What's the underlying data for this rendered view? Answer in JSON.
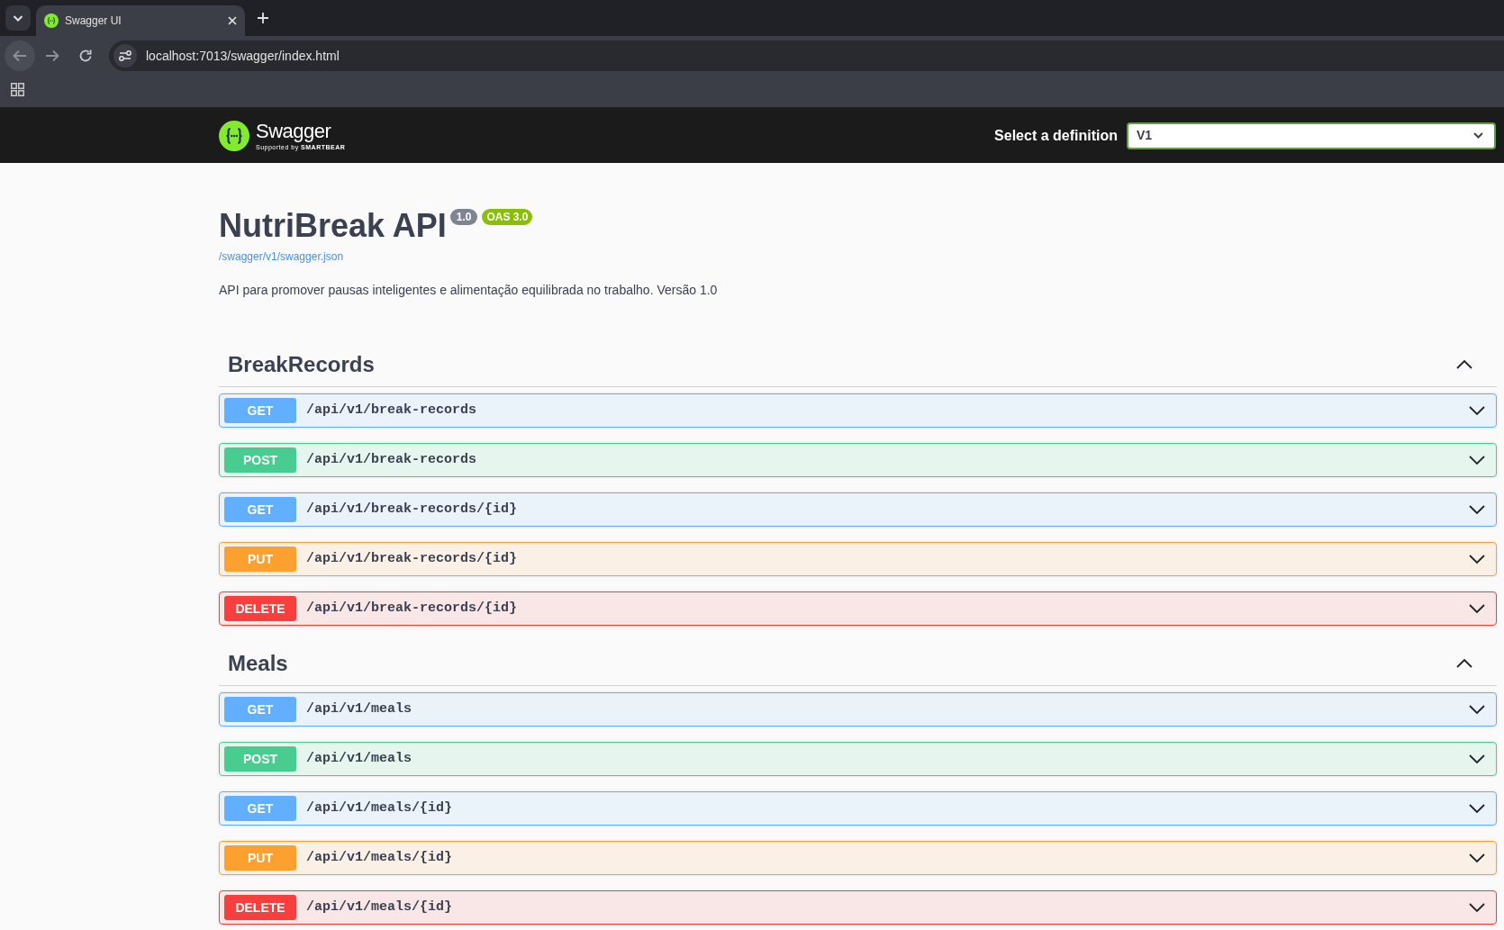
{
  "browser": {
    "tabs": [
      {
        "title": "Swagger UI",
        "selected": true
      }
    ],
    "address": "localhost:7013/swagger/index.html"
  },
  "header": {
    "brand": "Swagger",
    "tagline": "Supported by **SMARTBEAR**",
    "definition_label": "Select a definition",
    "definition_value": "V1"
  },
  "info": {
    "title": "NutriBreak API",
    "version": "1.0",
    "oas": "OAS 3.0",
    "spec_link": "/swagger/v1/swagger.json",
    "description": "API para promover pausas inteligentes e alimentação equilibrada no trabalho. Versão 1.0"
  },
  "sections": [
    {
      "name": "BreakRecords",
      "expanded": true,
      "operations": [
        {
          "method": "GET",
          "path": "/api/v1/break-records",
          "color": "#61affe",
          "expanded": false
        },
        {
          "method": "POST",
          "path": "/api/v1/break-records",
          "color": "#49cc90",
          "expanded": false
        },
        {
          "method": "GET",
          "path": "/api/v1/break-records/{id}",
          "color": "#61affe",
          "expanded": false
        },
        {
          "method": "PUT",
          "path": "/api/v1/break-records/{id}",
          "color": "#fca130",
          "expanded": false
        },
        {
          "method": "DELETE",
          "path": "/api/v1/break-records/{id}",
          "color": "#f93e3e",
          "expanded": false
        }
      ]
    },
    {
      "name": "Meals",
      "expanded": true,
      "operations": [
        {
          "method": "GET",
          "path": "/api/v1/meals",
          "color": "#61affe",
          "expanded": false
        },
        {
          "method": "POST",
          "path": "/api/v1/meals",
          "color": "#49cc90",
          "expanded": false
        },
        {
          "method": "GET",
          "path": "/api/v1/meals/{id}",
          "color": "#61affe",
          "expanded": false
        },
        {
          "method": "PUT",
          "path": "/api/v1/meals/{id}",
          "color": "#fca130",
          "expanded": false
        },
        {
          "method": "DELETE",
          "path": "/api/v1/meals/{id}",
          "color": "#f93e3e",
          "expanded": false
        }
      ]
    }
  ]
}
